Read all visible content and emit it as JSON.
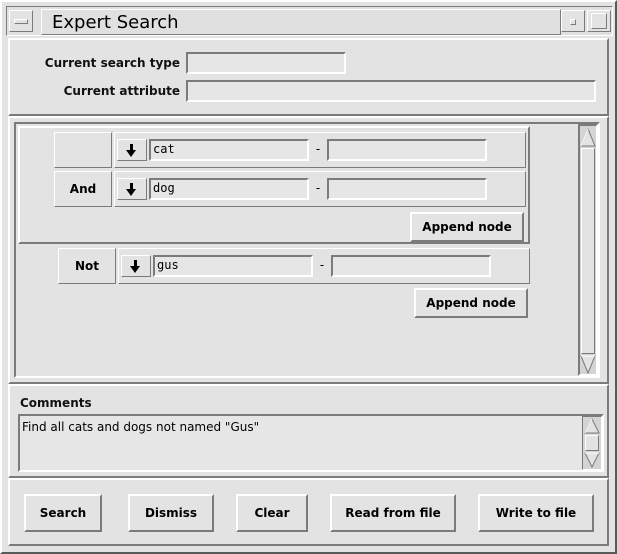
{
  "window": {
    "title": "Expert Search"
  },
  "header": {
    "search_type_label": "Current search type",
    "search_type_value": "",
    "attribute_label": "Current attribute",
    "attribute_value": ""
  },
  "tree": {
    "group": {
      "rows": [
        {
          "operator": "",
          "from_value": "cat",
          "separator": "-",
          "to_value": ""
        },
        {
          "operator": "And",
          "from_value": "dog",
          "separator": "-",
          "to_value": ""
        }
      ],
      "append_label": "Append node"
    },
    "outer": {
      "operator": "Not",
      "from_value": "gus",
      "separator": "-",
      "to_value": "",
      "append_label": "Append node"
    }
  },
  "comments": {
    "label": "Comments",
    "text": "Find all cats and dogs not named \"Gus\""
  },
  "footer": {
    "search": "Search",
    "dismiss": "Dismiss",
    "clear": "Clear",
    "read_from_file": "Read from file",
    "write_to_file": "Write to file"
  }
}
